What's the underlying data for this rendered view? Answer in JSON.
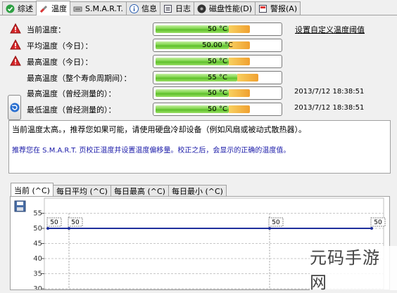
{
  "tabs": [
    {
      "label": "综述",
      "icon": "check-circle-icon"
    },
    {
      "label": "温度",
      "icon": "thermometer-icon",
      "active": true
    },
    {
      "label": "S.M.A.R.T.",
      "icon": "smart-icon"
    },
    {
      "label": "信息",
      "icon": "info-icon"
    },
    {
      "label": "日志",
      "icon": "log-icon"
    },
    {
      "label": "磁盘性能(D)",
      "icon": "disk-performance-icon"
    },
    {
      "label": "警报(A)",
      "icon": "alert-icon"
    }
  ],
  "rows": [
    {
      "label": "当前温度：",
      "value": "50 °C",
      "level": 0.75,
      "warn": true,
      "link": "设置自定义温度阈值"
    },
    {
      "label": "平均温度（今日）：",
      "value": "50.00 °C",
      "level": 0.75,
      "warn": true
    },
    {
      "label": "最高温度（今日）：",
      "value": "50 °C",
      "level": 0.75,
      "warn": true
    },
    {
      "label": "最高温度（整个寿命周期间）：",
      "value": "55 °C",
      "level": 0.82,
      "warn": false
    },
    {
      "label": "最高温度（曾经测量的）：",
      "value": "50 °C",
      "level": 0.75,
      "warn": false,
      "date": "2013/7/12 18:38:51"
    },
    {
      "label": "最低温度（曾经测量的）：",
      "value": "50 °C",
      "level": 0.75,
      "warn": false,
      "date": "2013/7/12 18:38:51"
    }
  ],
  "message": {
    "line1": "当前温度太高。，推荐您如果可能，请使用硬盘冷却设备（例如风扇或被动式散热器）。",
    "line2": "推荐您在 S.M.A.R.T. 页校正温度并设置温度偏移量。校正之后，会显示的正确的温度值。"
  },
  "graph_tabs": [
    "当前 (^C)",
    "每日平均 (^C)",
    "每日最高 (^C)",
    "每日最小 (^C)"
  ],
  "watermark": "元码手游网",
  "chart_data": {
    "type": "line",
    "yticks": [
      "55",
      "50",
      "45",
      "40",
      "35",
      "30"
    ],
    "ylim": [
      30,
      55
    ],
    "series": [
      {
        "values": [
          50,
          50,
          50,
          50
        ]
      }
    ],
    "point_labels": [
      "50",
      "50",
      "50",
      "50"
    ],
    "line_color": "#1f2f9c"
  }
}
